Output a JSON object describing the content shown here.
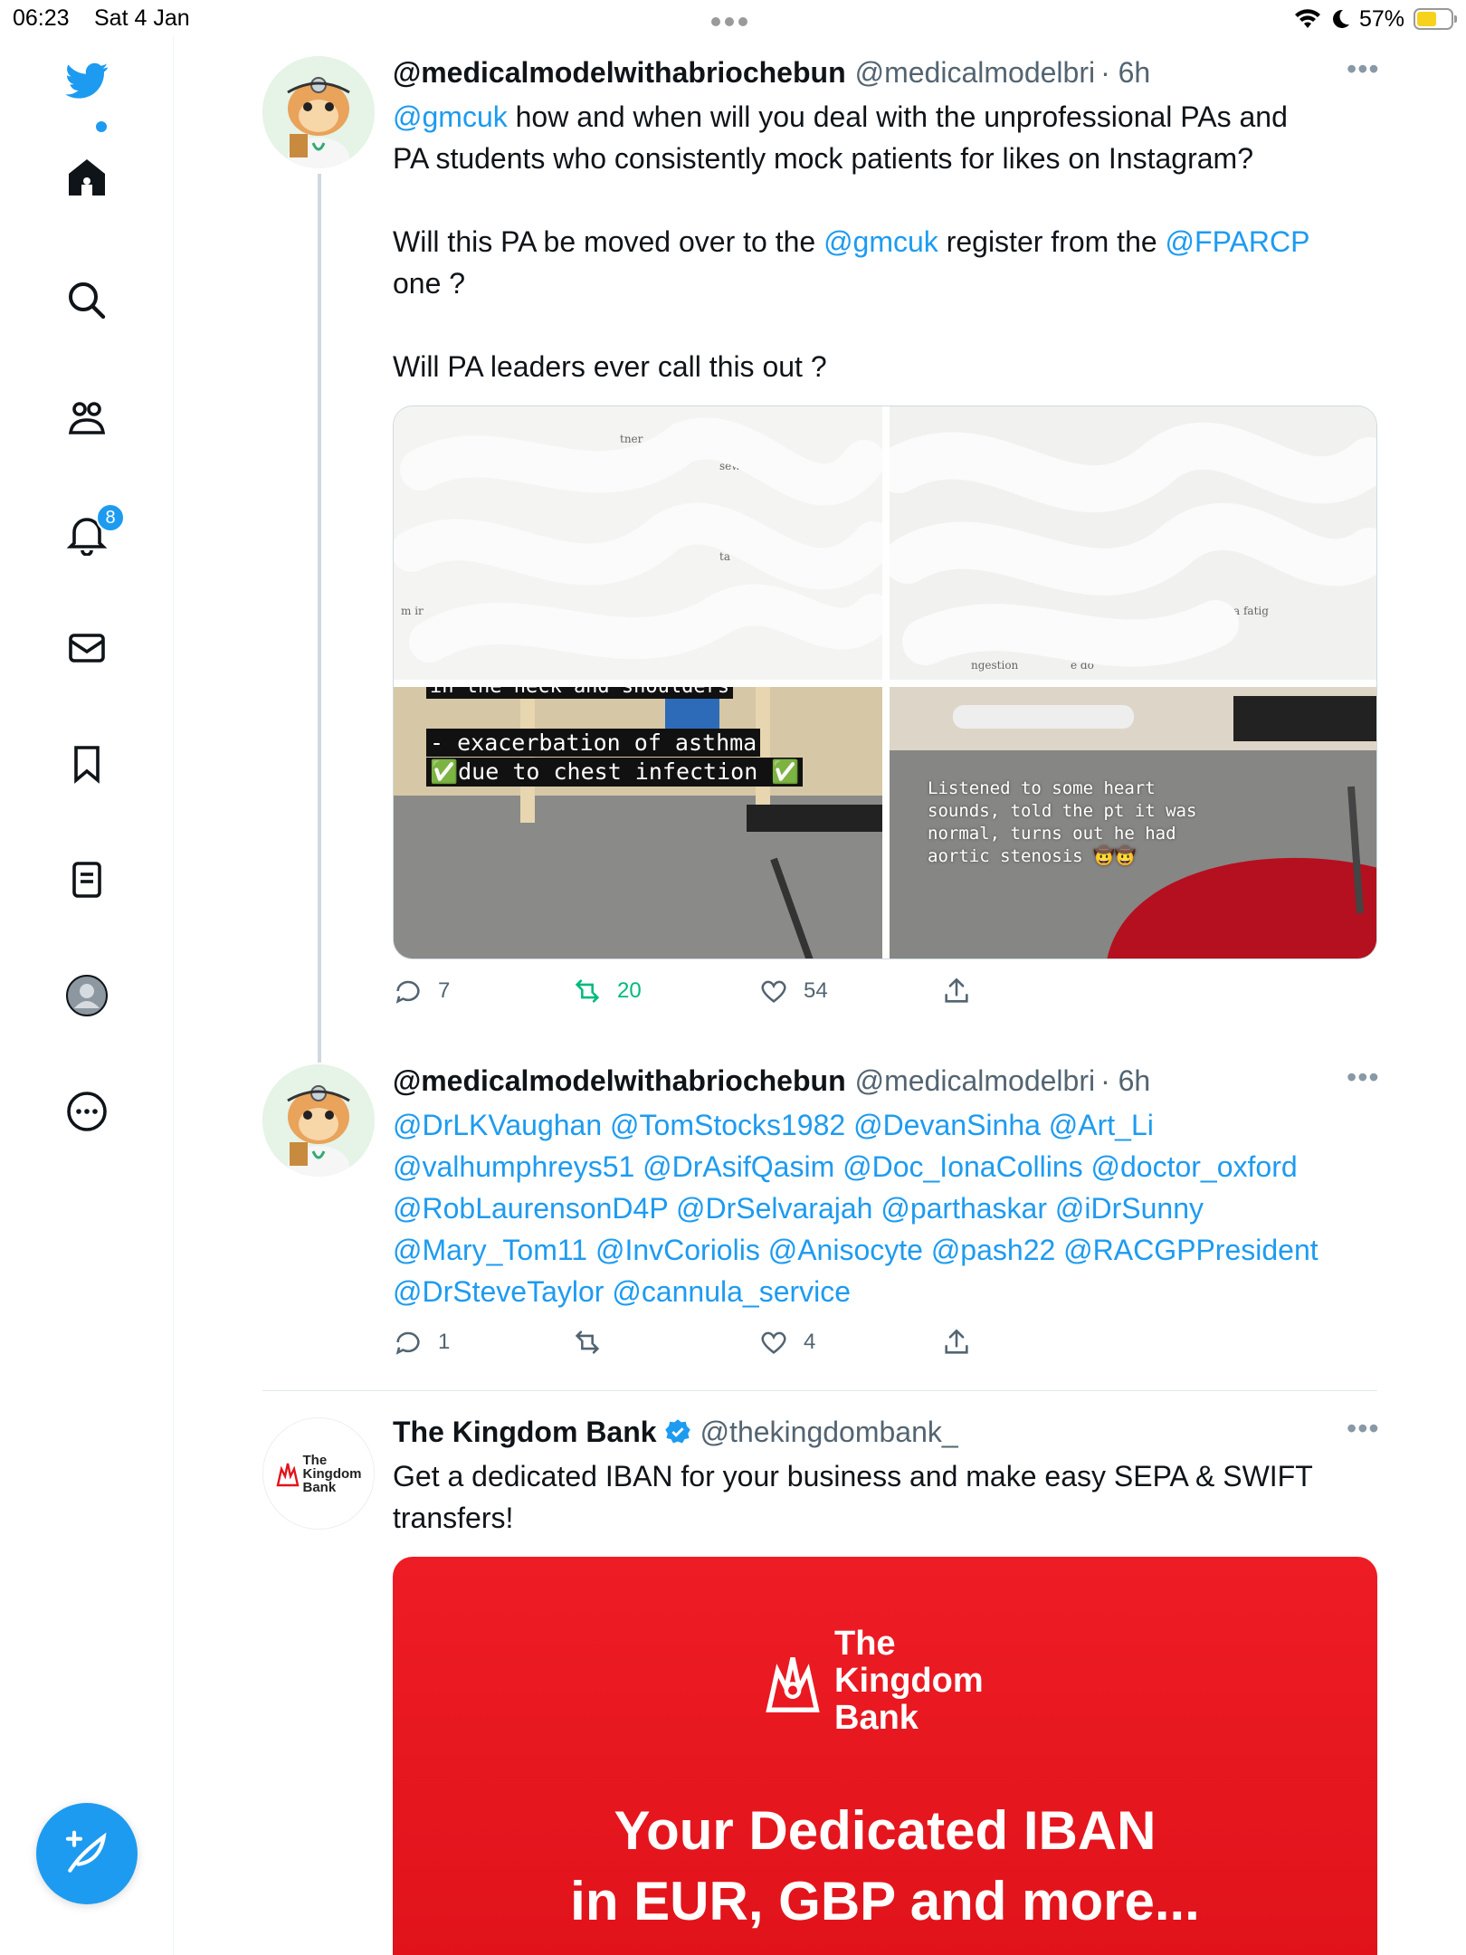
{
  "status_bar": {
    "time": "06:23",
    "date": "Sat 4 Jan",
    "battery_pct": "57%",
    "battery_level": 0.57
  },
  "sidebar": {
    "notifications_badge": "8",
    "items": [
      "twitter-logo",
      "home-icon",
      "search-icon",
      "communities-icon",
      "notifications-icon",
      "messages-icon",
      "bookmarks-icon",
      "lists-icon",
      "profile-icon",
      "more-icon"
    ]
  },
  "tweets": [
    {
      "name": "@medicalmodelwithabriochebun",
      "handle": "@medicalmodelbri",
      "time": "· 6h",
      "text": {
        "l1_mention": "@gmcuk",
        "l1_rest": " how and when will you deal with the unprofessional PAs and",
        "l2": "PA students who consistently mock patients for likes on Instagram?",
        "l3_pre": "Will this PA be moved over to the ",
        "l3_mention1": "@gmcuk",
        "l3_mid": " register from the ",
        "l3_mention2": "@FPARCP",
        "l4": "one ?",
        "l5": "Will PA leaders ever call this out ?"
      },
      "media": {
        "caption_top_partial": "in the neck and shoulders",
        "caption_line1": "- exacerbation of asthma",
        "caption_line2": "✅due to chest infection ✅",
        "caption_right": "Listened to some heart\nsounds, told the pt it was\nnormal, turns out he had\naortic stenosis 🤠🤠"
      },
      "replies": "7",
      "retweets": "20",
      "likes": "54"
    },
    {
      "name": "@medicalmodelwithabriochebun",
      "handle": "@medicalmodelbri",
      "time": "· 6h",
      "lines": [
        "@DrLKVaughan @TomStocks1982 @DevanSinha @Art_Li",
        "@valhumphreys51 @DrAsifQasim @Doc_IonaCollins @doctor_oxford",
        "@RobLaurensonD4P @DrSelvarajah @parthaskar @iDrSunny",
        "@Mary_Tom11 @InvCoriolis @Anisocyte @pash22 @RACGPPresident",
        "@DrSteveTaylor @cannula_service"
      ],
      "replies": "1",
      "retweets": "",
      "likes": "4"
    }
  ],
  "ad": {
    "name": "The Kingdom Bank",
    "handle": "@thekingdombank_",
    "text_l1": "Get a dedicated IBAN for your business and make easy SEPA & SWIFT",
    "text_l2": "transfers!",
    "logo_small": [
      "The",
      "Kingdom",
      "Bank"
    ],
    "card_brand": [
      "The",
      "Kingdom",
      "Bank"
    ],
    "headline_l1": "Your Dedicated IBAN",
    "headline_l2": "in EUR, GBP and more...",
    "brand_color": "#ee1c25"
  },
  "colors": {
    "accent": "#1d9bf0",
    "retweet": "#00ba7c",
    "muted": "#536471"
  }
}
